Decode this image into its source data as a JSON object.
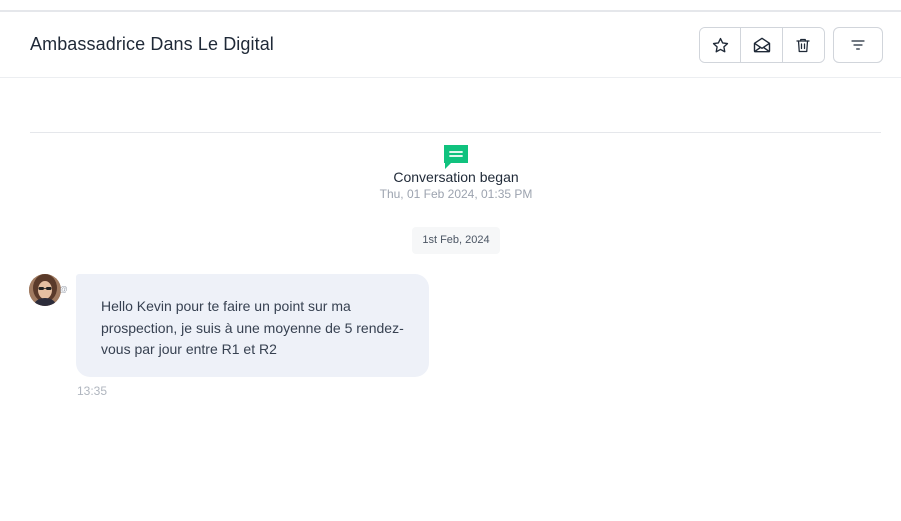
{
  "conversation": {
    "title": "Ambassadrice Dans Le Digital",
    "actions": {
      "star": "star-icon",
      "mark_unread": "envelope-open-icon",
      "delete": "trash-icon",
      "filter": "filter-icon"
    }
  },
  "timeline": {
    "began_label": "Conversation began",
    "began_time": "Thu, 01 Feb 2024, 01:35 PM",
    "date_separator": "1st Feb, 2024"
  },
  "messages": [
    {
      "text": "Hello Kevin pour te faire un point sur ma prospection, je suis à une moyenne de 5 rendez-vous par jour entre R1 et R2",
      "time": "13:35",
      "channel_badge": "@"
    }
  ],
  "colors": {
    "accent": "#10c27e",
    "bubble": "#eef1f8",
    "border": "#d1d5db"
  }
}
